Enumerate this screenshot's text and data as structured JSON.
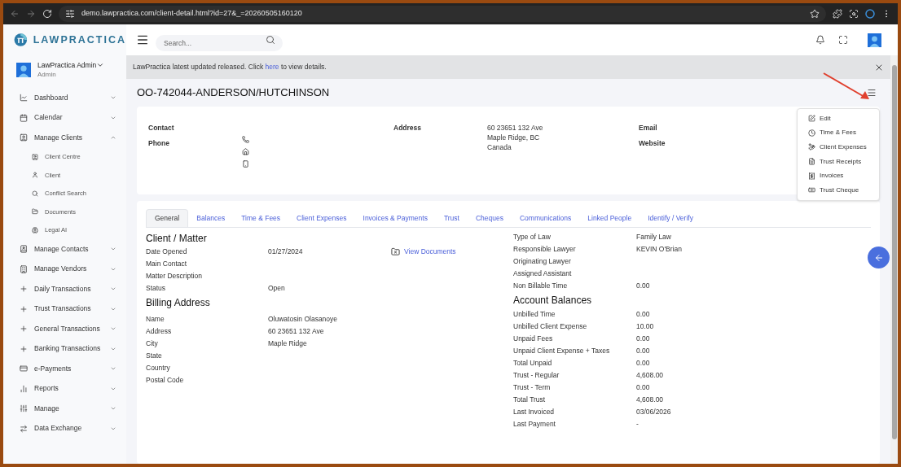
{
  "browser": {
    "url": "demo.lawpractica.com/client-detail.html?id=27&_=20260505160120"
  },
  "logo": {
    "text": "LAWPRACTICA"
  },
  "user": {
    "name": "LawPractica Admin",
    "role": "Admin"
  },
  "search": {
    "placeholder": "Search..."
  },
  "banner": {
    "before": "LawPractica latest updated released. Click ",
    "link": "here",
    "after": " to view details."
  },
  "sidebar": {
    "items": [
      {
        "label": "Dashboard",
        "expanded": false
      },
      {
        "label": "Calendar",
        "expanded": false
      },
      {
        "label": "Manage Clients",
        "expanded": true,
        "children": [
          {
            "label": "Client Centre"
          },
          {
            "label": "Client"
          },
          {
            "label": "Conflict Search"
          },
          {
            "label": "Documents"
          },
          {
            "label": "Legal AI"
          }
        ]
      },
      {
        "label": "Manage Contacts",
        "expanded": false
      },
      {
        "label": "Manage Vendors",
        "expanded": false
      },
      {
        "label": "Daily Transactions",
        "expanded": false
      },
      {
        "label": "Trust Transactions",
        "expanded": false
      },
      {
        "label": "General Transactions",
        "expanded": false
      },
      {
        "label": "Banking Transactions",
        "expanded": false
      },
      {
        "label": "e-Payments",
        "expanded": false
      },
      {
        "label": "Reports",
        "expanded": false
      },
      {
        "label": "Manage",
        "expanded": false
      },
      {
        "label": "Data Exchange",
        "expanded": false
      }
    ]
  },
  "page_title": "OO-742044-ANDERSON/HUTCHINSON",
  "contact_card": {
    "contact_label": "Contact",
    "phone_label": "Phone",
    "address_label": "Address",
    "address_lines": [
      "60 23651 132 Ave",
      "Maple Ridge, BC",
      "Canada"
    ],
    "email_label": "Email",
    "website_label": "Website"
  },
  "actions_menu": {
    "items": [
      "Edit",
      "Time & Fees",
      "Client Expenses",
      "Trust Receipts",
      "Invoices",
      "Trust Cheque"
    ]
  },
  "tabs": [
    {
      "label": "General",
      "selected": true
    },
    {
      "label": "Balances",
      "selected": false
    },
    {
      "label": "Time & Fees",
      "selected": false
    },
    {
      "label": "Client Expenses",
      "selected": false
    },
    {
      "label": "Invoices & Payments",
      "selected": false
    },
    {
      "label": "Trust",
      "selected": false
    },
    {
      "label": "Cheques",
      "selected": false
    },
    {
      "label": "Communications",
      "selected": false
    },
    {
      "label": "Linked People",
      "selected": false
    },
    {
      "label": "Identify / Verify",
      "selected": false
    }
  ],
  "client_matter": {
    "heading": "Client / Matter",
    "view_documents": "View Documents",
    "rows": [
      {
        "label": "Date Opened",
        "value": "01/27/2024"
      },
      {
        "label": "Main Contact"
      },
      {
        "label": "Matter Description"
      },
      {
        "label": "Status",
        "value": "Open"
      }
    ]
  },
  "billing_address": {
    "heading": "Billing Address",
    "rows": [
      {
        "label": "Name",
        "value": "Oluwatosin Olasanoye"
      },
      {
        "label": "Address",
        "value": "60 23651 132 Ave"
      },
      {
        "label": "City",
        "value": "Maple Ridge"
      },
      {
        "label": "State"
      },
      {
        "label": "Country"
      },
      {
        "label": "Postal Code"
      }
    ]
  },
  "matter_info": {
    "rows": [
      {
        "label": "Type of Law",
        "value": "Family Law"
      },
      {
        "label": "Responsible Lawyer",
        "value": "KEVIN O'Brian"
      },
      {
        "label": "Originating Lawyer"
      },
      {
        "label": "Assigned Assistant"
      },
      {
        "label": "Non Billable Time",
        "value": "0.00"
      }
    ]
  },
  "account_balances": {
    "heading": "Account Balances",
    "rows": [
      {
        "label": "Unbilled Time",
        "value": "0.00"
      },
      {
        "label": "Unbilled Client Expense",
        "value": "10.00"
      },
      {
        "label": "Unpaid Fees",
        "value": "0.00"
      },
      {
        "label": "Unpaid Client Expense + Taxes",
        "value": "0.00"
      },
      {
        "label": "Total Unpaid",
        "value": "0.00"
      },
      {
        "label": "Trust - Regular",
        "value": "4,608.00"
      },
      {
        "label": "Trust - Term",
        "value": "0.00"
      },
      {
        "label": "Total Trust",
        "value": "4,608.00"
      },
      {
        "label": "Last Invoiced",
        "value": "03/06/2026"
      },
      {
        "label": "Last Payment",
        "value": "-"
      }
    ]
  }
}
